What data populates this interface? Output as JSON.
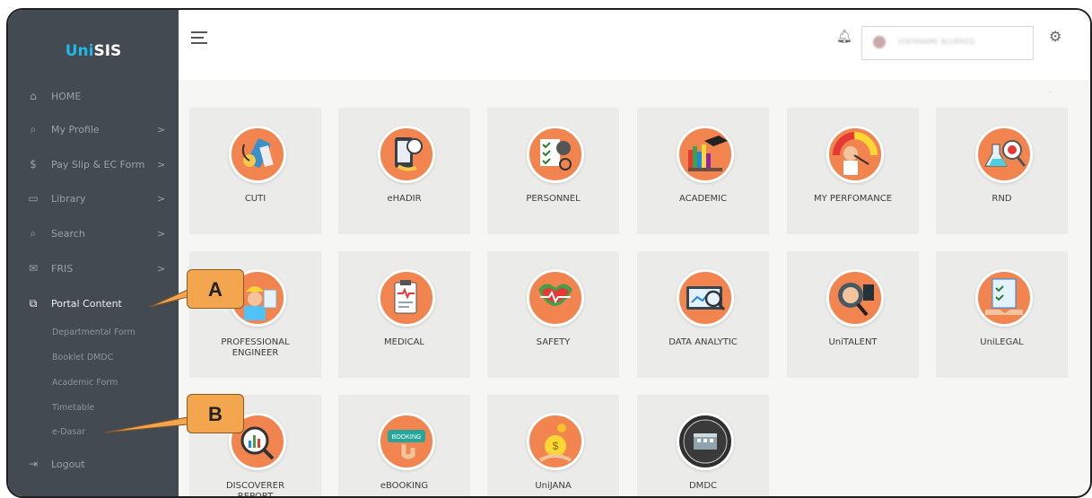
{
  "app": {
    "logo_prefix": "Uni",
    "logo_suffix": "SIS"
  },
  "sidebar": {
    "items": [
      {
        "label": "HOME",
        "icon": "home-icon"
      },
      {
        "label": "My Profile",
        "icon": "search-icon",
        "chevron": ">"
      },
      {
        "label": "Pay Slip & EC Form",
        "icon": "dollar-icon",
        "chevron": ">"
      },
      {
        "label": "Library",
        "icon": "book-icon",
        "chevron": ">"
      },
      {
        "label": "Search",
        "icon": "search-icon",
        "chevron": ">"
      },
      {
        "label": "FRIS",
        "icon": "mail-icon",
        "chevron": ">"
      },
      {
        "label": "Portal Content",
        "icon": "copy-icon"
      }
    ],
    "sub_items": [
      "Departmental Form",
      "Booklet DMDC",
      "Academic Form",
      "Timetable",
      "e-Dasar"
    ],
    "logout": "Logout"
  },
  "topbar": {
    "username": "USERNAME BLURRED",
    "dot": "."
  },
  "tiles": [
    {
      "label": "CUTI",
      "icon": "medical-tools-icon"
    },
    {
      "label": "eHADIR",
      "icon": "fingerprint-icon"
    },
    {
      "label": "PERSONNEL",
      "icon": "checklist-icon"
    },
    {
      "label": "ACADEMIC",
      "icon": "graduation-cap-icon"
    },
    {
      "label": "MY PERFOMANCE",
      "icon": "performance-gauge-icon"
    },
    {
      "label": "RND",
      "icon": "research-flask-icon"
    },
    {
      "label": "PROFESSIONAL\nENGINEER",
      "icon": "engineer-icon"
    },
    {
      "label": "MEDICAL",
      "icon": "clipboard-icon"
    },
    {
      "label": "SAFETY",
      "icon": "heart-shield-icon"
    },
    {
      "label": "DATA ANALYTIC",
      "icon": "analytics-icon"
    },
    {
      "label": "UniTALENT",
      "icon": "talent-search-icon"
    },
    {
      "label": "UniLEGAL",
      "icon": "legal-handshake-icon"
    },
    {
      "label": "DISCOVERER\nREPORT",
      "icon": "report-search-icon"
    },
    {
      "label": "eBOOKING",
      "icon": "booking-icon"
    },
    {
      "label": "UniJANA",
      "icon": "money-bag-icon"
    },
    {
      "label": "DMDC",
      "icon": "building-seal-icon"
    }
  ],
  "callouts": {
    "a": "A",
    "b": "B"
  },
  "colors": {
    "sidebar": "#434a51",
    "accent": "#f1844f",
    "callout": "#f4a64f",
    "logo_blue": "#1fb8e8"
  }
}
